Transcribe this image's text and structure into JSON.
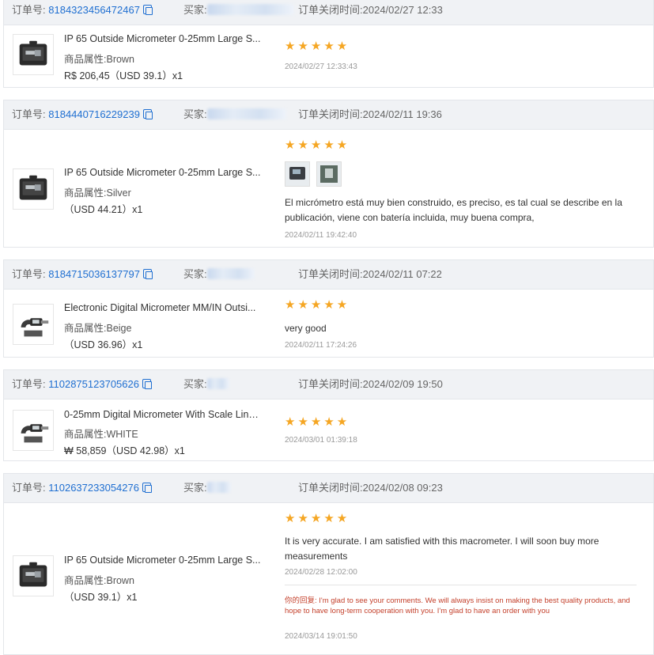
{
  "labels": {
    "order_no": "订单号:",
    "buyer": "买家:",
    "closed_time": "订单关闭时间:",
    "attr": "商品属性:",
    "your_reply": "你的回复:"
  },
  "colors": {
    "link": "#1f6fd1",
    "star": "#f5a623",
    "reply": "#c4412c",
    "header_bg": "#f0f2f5"
  },
  "orders": [
    {
      "order_no": "8184323456472467",
      "closed_time": "2024/02/27 12:33",
      "product_title": "IP 65 Outside Micrometer 0-25mm Large S...",
      "attribute": "Brown",
      "price": "R$ 206,45（USD  39.1）x1",
      "stars": "★★★★★",
      "review_time": "2024/02/27 12:33:43"
    },
    {
      "order_no": "8184440716229239",
      "closed_time": "2024/02/11 19:36",
      "product_title": "IP 65 Outside Micrometer 0-25mm Large S...",
      "attribute": "Silver",
      "price": "（USD  44.21）x1",
      "stars": "★★★★★",
      "review_text": "El micrómetro está muy bien construido, es preciso, es tal cual se describe en la publicación, viene con batería incluida, muy buena compra,",
      "review_time": "2024/02/11 19:42:40"
    },
    {
      "order_no": "8184715036137797",
      "closed_time": "2024/02/11 07:22",
      "product_title": "Electronic Digital Micrometer MM/IN Outsi...",
      "attribute": "Beige",
      "price": "（USD  36.96）x1",
      "stars": "★★★★★",
      "review_text": "very good",
      "review_time": "2024/02/11 17:24:26"
    },
    {
      "order_no": "1102875123705626",
      "closed_time": "2024/02/09 19:50",
      "product_title": "0-25mm Digital Micrometer With Scale Line...",
      "attribute": "WHITE",
      "price": "₩ 58,859（USD  42.98）x1",
      "stars": "★★★★★",
      "review_time": "2024/03/01 01:39:18"
    },
    {
      "order_no": "1102637233054276",
      "closed_time": "2024/02/08 09:23",
      "product_title": "IP 65 Outside Micrometer 0-25mm Large S...",
      "attribute": "Brown",
      "price": "（USD  39.1）x1",
      "stars": "★★★★★",
      "review_text": "It is very accurate. I am satisfied with this macrometer. I will soon buy more measurements",
      "review_time": "2024/02/28 12:02:00",
      "reply_text": "I'm glad to see your comments. We will always insist on making the best quality products, and hope to have long-term cooperation with you. I'm glad to have an order with you",
      "reply_time": "2024/03/14 19:01:50"
    }
  ]
}
